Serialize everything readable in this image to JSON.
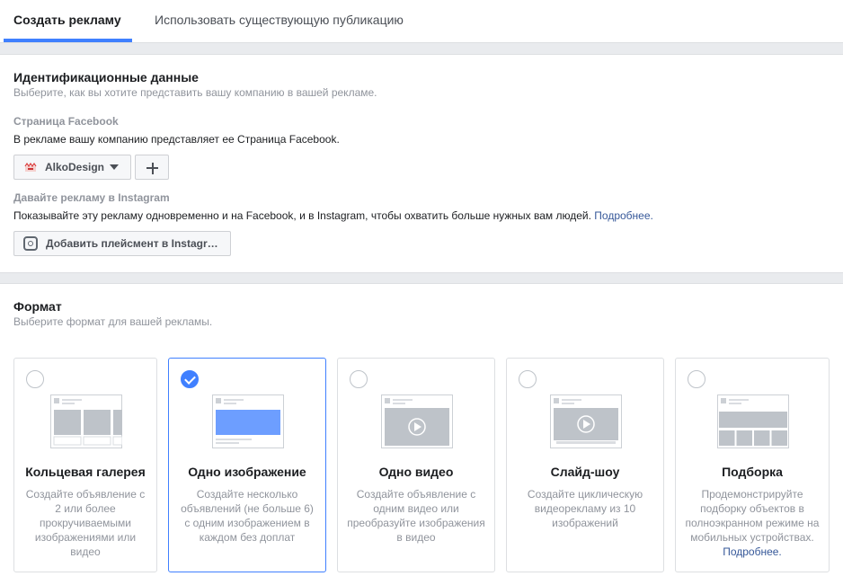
{
  "tabs": [
    {
      "label": "Создать рекламу",
      "active": true
    },
    {
      "label": "Использовать существующую публикацию",
      "active": false
    }
  ],
  "identity": {
    "title": "Идентификационные данные",
    "subtitle": "Выберите, как вы хотите представить вашу компанию в вашей рекламе.",
    "page_label": "Страница Facebook",
    "page_desc": "В рекламе вашу компанию представляет ее Страница Facebook.",
    "page_name": "AlkoDesign",
    "add_page_icon": "plus-icon",
    "instagram_label": "Давайте рекламу в Instagram",
    "instagram_desc": "Показывайте эту рекламу одновременно и на Facebook, и в Instagram, чтобы охватить больше нужных вам людей.",
    "instagram_link": "Подробнее.",
    "instagram_button": "Добавить плейсмент в Instagr…"
  },
  "format": {
    "title": "Формат",
    "subtitle": "Выберите формат для вашей рекламы.",
    "cards": [
      {
        "title": "Кольцевая галерея",
        "desc": "Создайте объявление с 2 или более прокручиваемыми изображениями или видео",
        "selected": false,
        "icon": "carousel-icon"
      },
      {
        "title": "Одно изображение",
        "desc": "Создайте несколько объявлений (не больше 6) с одним изображением в каждом без доплат",
        "selected": true,
        "icon": "single-image-icon"
      },
      {
        "title": "Одно видео",
        "desc": "Создайте объявление с одним видео или преобразуйте изображения в видео",
        "selected": false,
        "icon": "video-icon"
      },
      {
        "title": "Слайд-шоу",
        "desc": "Создайте циклическую видеорекламу из 10 изображений",
        "selected": false,
        "icon": "slideshow-icon"
      },
      {
        "title": "Подборка",
        "desc": "Продемонстрируйте подборку объектов в полноэкранном режиме на мобильных устройствах.",
        "link": "Подробнее.",
        "selected": false,
        "icon": "collection-icon"
      }
    ]
  },
  "colors": {
    "accent": "#4080ff",
    "link": "#365899",
    "muted": "#90949c",
    "background": "#e9ebee"
  }
}
